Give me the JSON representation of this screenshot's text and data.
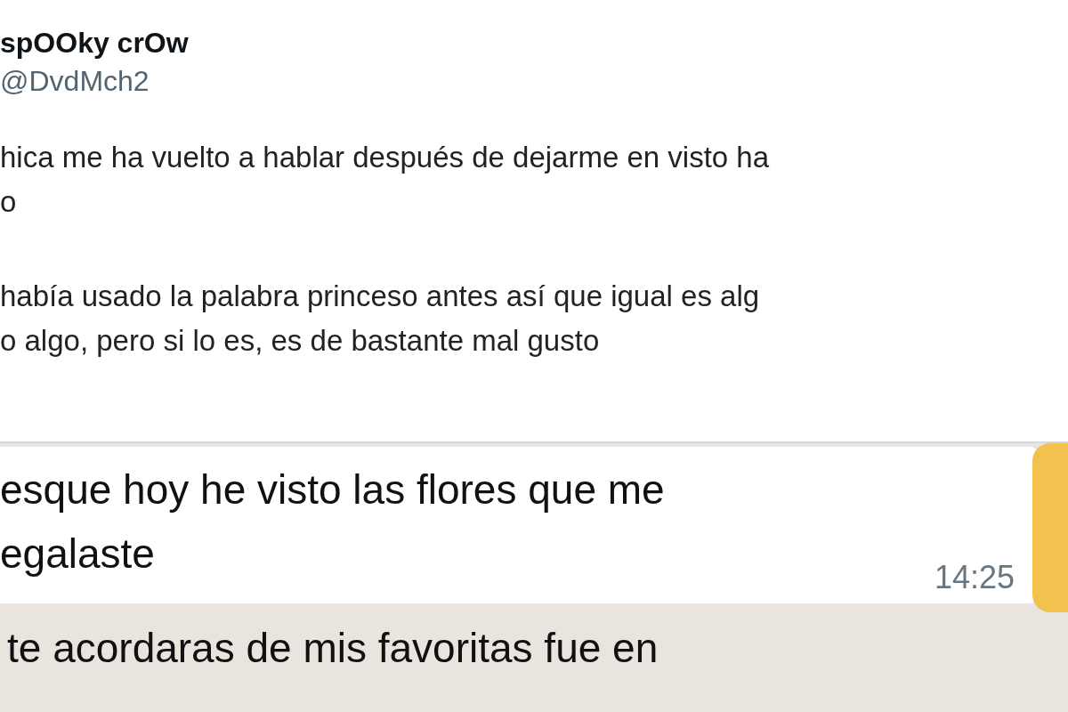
{
  "tweet": {
    "display_name": "spOOky crOw",
    "handle": "@DvdMch2",
    "paragraphs": [
      [
        "hica me ha vuelto a hablar después de dejarme en visto ha",
        "o"
      ],
      [
        "había usado la palabra princeso antes así que igual es alg",
        "o algo, pero si lo es, es de bastante mal gusto"
      ]
    ]
  },
  "chat": {
    "messages": [
      {
        "lines": [
          "esque hoy he visto las flores que me",
          "egalaste"
        ],
        "time": "14:25"
      },
      {
        "lines": [
          "te acordaras de mis favoritas fue en"
        ]
      }
    ]
  }
}
